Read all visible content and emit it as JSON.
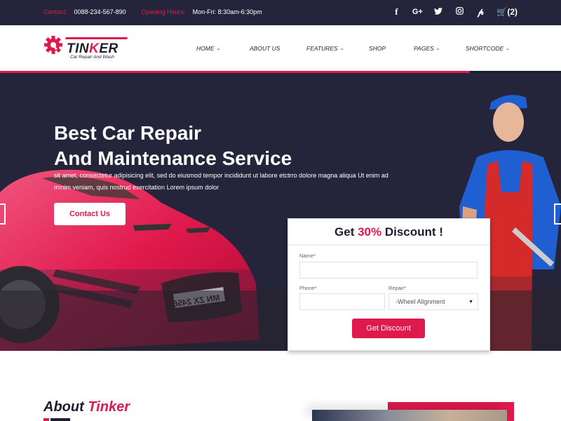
{
  "topbar": {
    "contact_label": "Contact:",
    "contact_value": "0088-234-567-890",
    "hours_label": "Opening Hours:",
    "hours_value": "Mon-Fri: 8:30am-6:30pm",
    "social": [
      {
        "icon": "facebook-icon",
        "glyph": "f"
      },
      {
        "icon": "google-plus-icon",
        "glyph": "G+"
      },
      {
        "icon": "twitter-icon",
        "glyph": "🐦"
      },
      {
        "icon": "instagram-icon",
        "glyph": "◙"
      },
      {
        "icon": "pinterest-icon",
        "glyph": "℗"
      }
    ],
    "cart_count": "(2)"
  },
  "header": {
    "logo_name": "TINKER",
    "logo_tagline": "Car Repair And Wash",
    "nav": [
      {
        "label": "HOME",
        "dropdown": true
      },
      {
        "label": "ABOUT US",
        "dropdown": false
      },
      {
        "label": "FEATURES",
        "dropdown": true
      },
      {
        "label": "SHOP",
        "dropdown": false
      },
      {
        "label": "PAGES",
        "dropdown": true
      },
      {
        "label": "SHORTCODE",
        "dropdown": true
      }
    ]
  },
  "hero": {
    "title_line1": "Best Car Repair",
    "title_line2": "And Maintenance Service",
    "text": "sit amet, consectetur adipisicing elit, sed do eiusmod tempor incididunt ut labore etctrro dolore magna aliqua Ut enim ad minim veniam, quis nostrud exercitation Lorem ipsum dolor",
    "contact_button": "Contact Us",
    "plate": "MN ZX 2456"
  },
  "form": {
    "title_pre": "Get ",
    "title_highlight": "30%",
    "title_post": " Discount !",
    "name_label": "Name*",
    "name_value": "",
    "phone_label": "Phone*",
    "phone_value": "",
    "repair_label": "Repair*",
    "repair_selected": "-Wheel Alignment",
    "submit": "Get Discount"
  },
  "about": {
    "title_pre": "About ",
    "title_highlight": "Tinker"
  },
  "colors": {
    "accent": "#e0194c",
    "dark": "#24253b"
  }
}
